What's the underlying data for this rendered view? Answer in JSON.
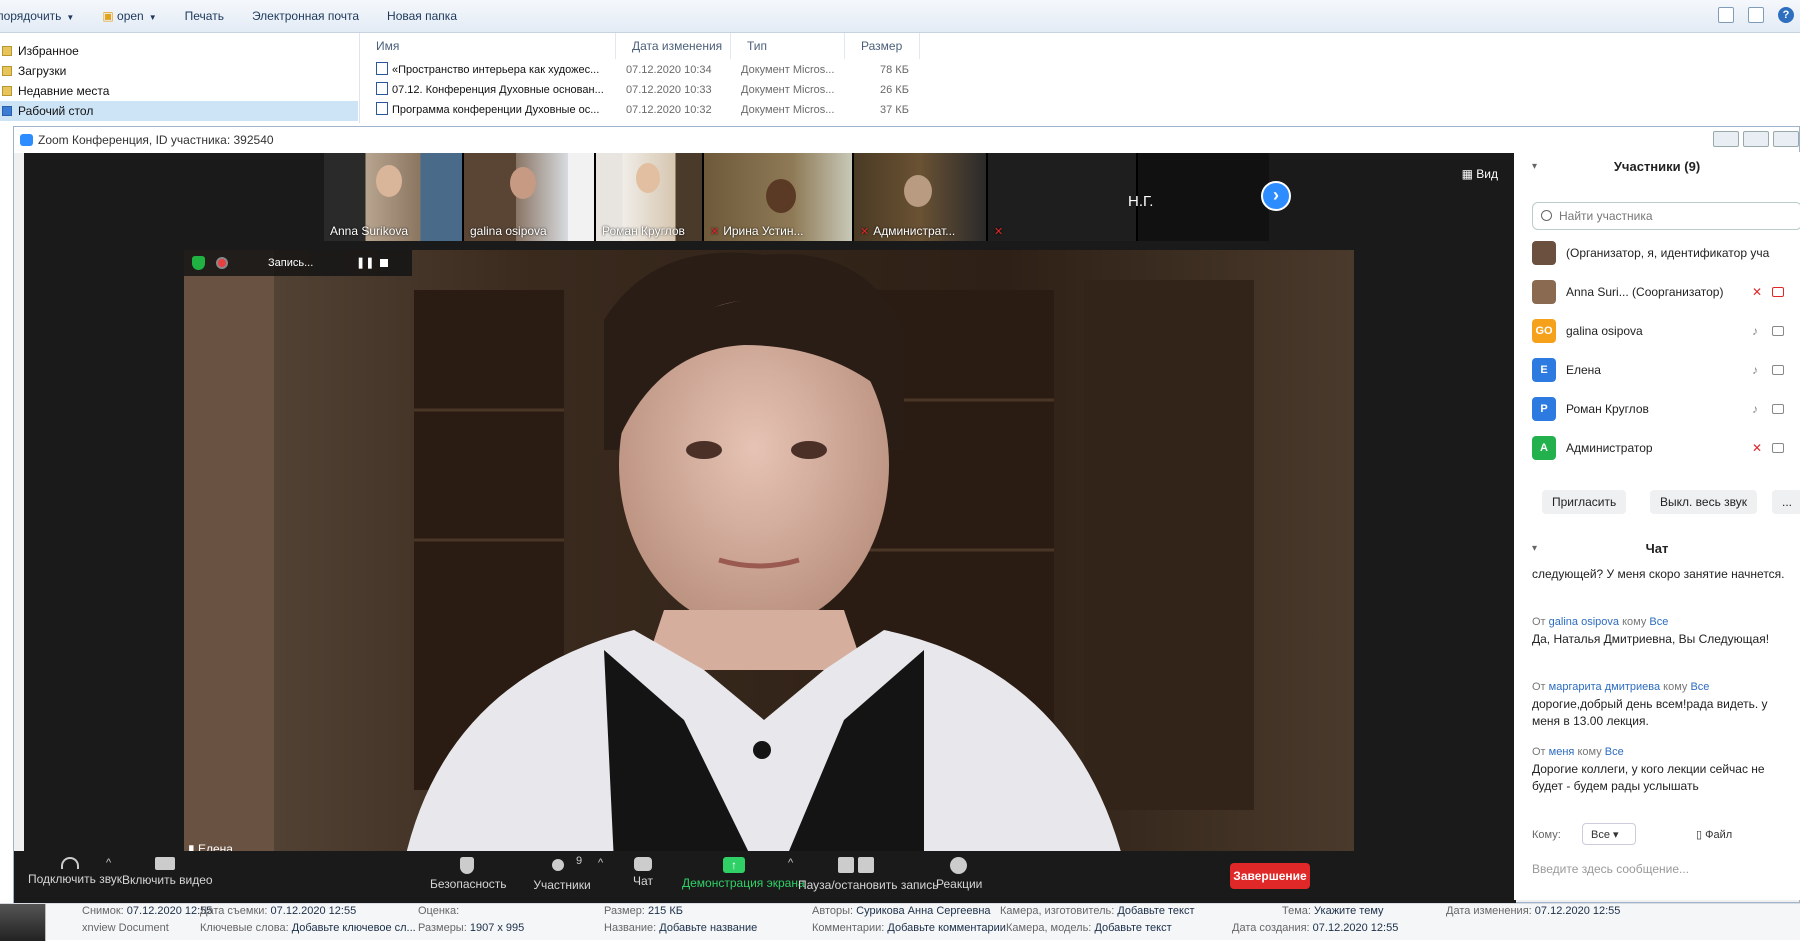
{
  "explorer": {
    "toolbar": {
      "organize": "Упорядочить",
      "open": "open",
      "print": "Печать",
      "email": "Электронная почта",
      "new_folder": "Новая папка"
    },
    "nav": [
      "Избранное",
      "Загрузки",
      "Недавние места",
      "Рабочий стол"
    ],
    "columns": {
      "name": "Имя",
      "date": "Дата изменения",
      "type": "Тип",
      "size": "Размер"
    },
    "files": [
      {
        "name": "«Пространство интерьера как художес...",
        "date": "07.12.2020 10:34",
        "type": "Документ Micros...",
        "size": "78 КБ"
      },
      {
        "name": "07.12. Конференция Духовные основан...",
        "date": "07.12.2020 10:33",
        "type": "Документ Micros...",
        "size": "26 КБ"
      },
      {
        "name": "Программа конференции Духовные ос...",
        "date": "07.12.2020 10:32",
        "type": "Документ Micros...",
        "size": "37 КБ"
      }
    ]
  },
  "zoom": {
    "title": "Zoom Конференция, ID участника: 392540",
    "view_label": "Вид",
    "thumbnails": [
      {
        "name": "Anna Surikova",
        "muted": false
      },
      {
        "name": "galina osipova",
        "muted": false
      },
      {
        "name": "Роман Круглов",
        "muted": false
      },
      {
        "name": "Ирина Устин...",
        "muted": true
      },
      {
        "name": "Администрат...",
        "muted": true
      }
    ],
    "ng_label": "Н.Г.",
    "recording": {
      "label": "Запись..."
    },
    "speaker_name": "Елена",
    "toolbar": {
      "audio": "Подключить звук",
      "video": "Включить видео",
      "security": "Безопасность",
      "participants": "Участники",
      "participants_count": "9",
      "chat": "Чат",
      "share": "Демонстрация экрана",
      "record": "Пауза/остановить запись",
      "reactions": "Реакции",
      "end": "Завершение"
    }
  },
  "sidebar": {
    "participants_header": "Участники (9)",
    "search_placeholder": "Найти участника",
    "participants": [
      {
        "initials": "",
        "name": "(Организатор, я, идентификатор уча",
        "color": "#6b5040"
      },
      {
        "initials": "",
        "name": "Anna Suri... (Соорганизатор)",
        "color": "#8a6a50"
      },
      {
        "initials": "GO",
        "name": "galina osipova",
        "color": "#f5a11c"
      },
      {
        "initials": "E",
        "name": "Елена",
        "color": "#2d7be0"
      },
      {
        "initials": "Р",
        "name": "Роман Круглов",
        "color": "#2d7be0"
      },
      {
        "initials": "А",
        "name": "Администратор",
        "color": "#22b14c"
      }
    ],
    "invite": "Пригласить",
    "mute_all": "Выкл. весь звук",
    "more": "...",
    "chat_header": "Чат",
    "chat": [
      {
        "from": "",
        "to": "",
        "text": "следующей? У меня скоро занятие начнется."
      },
      {
        "from": "galina osipova",
        "to": "Все",
        "text": "Да, Наталья Дмитриевна, Вы Следующая!"
      },
      {
        "from": "маргарита дмитриева",
        "to": "Все",
        "text": "дорогие,добрый день всем!рада видеть. у меня в 13.00 лекция."
      },
      {
        "from": "меня",
        "to": "Все",
        "text": "Дорогие коллеги, у кого лекции сейчас не будет - будем рады услышать"
      }
    ],
    "meta_from": "От",
    "meta_to": "кому",
    "to_label": "Кому:",
    "to_value": "Все",
    "file_label": "Файл",
    "input_placeholder": "Введите здесь сообщение..."
  },
  "statusbar": {
    "row1": [
      {
        "k": "Снимок:",
        "v": "07.12.2020 12:55"
      },
      {
        "k": "Дата съемки:",
        "v": "07.12.2020 12:55"
      },
      {
        "k": "Оценка:",
        "v": ""
      },
      {
        "k": "Размер:",
        "v": "215 КБ"
      },
      {
        "k": "Авторы:",
        "v": "Сурикова Анна Сергеевна"
      },
      {
        "k": "Камера, изготовитель:",
        "v": "Добавьте текст"
      },
      {
        "k": "Тема:",
        "v": "Укажите тему"
      },
      {
        "k": "Дата изменения:",
        "v": "07.12.2020 12:55"
      }
    ],
    "row2": [
      {
        "k": "xnview Document",
        "v": ""
      },
      {
        "k": "Ключевые слова:",
        "v": "Добавьте ключевое сл..."
      },
      {
        "k": "Размеры:",
        "v": "1907 x 995"
      },
      {
        "k": "Название:",
        "v": "Добавьте название"
      },
      {
        "k": "Комментарии:",
        "v": "Добавьте комментарии"
      },
      {
        "k": "Камера, модель:",
        "v": "Добавьте текст"
      },
      {
        "k": "Дата создания:",
        "v": "07.12.2020 12:55"
      }
    ]
  }
}
